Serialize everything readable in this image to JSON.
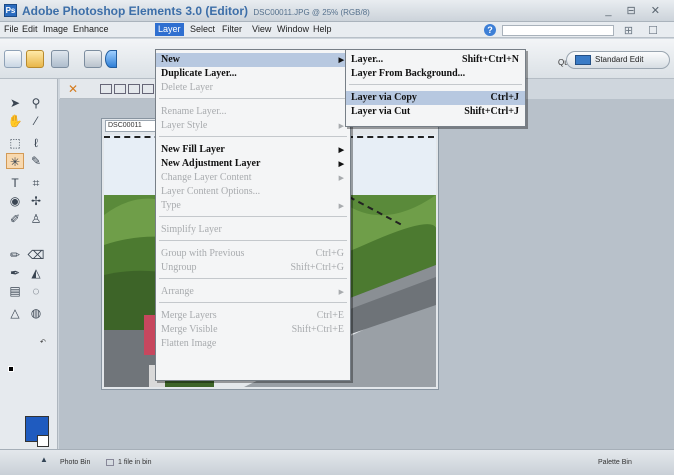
{
  "window": {
    "title": "Adobe Photoshop Elements 3.0 (Editor)",
    "subtitle": "DSC00011.JPG @ 25% (RGB/8)",
    "controls": "_ ⊟ ✕"
  },
  "menubar": {
    "items": [
      "File",
      "Edit",
      "Image",
      "Enhance",
      "Layer",
      "Select",
      "Filter",
      "View",
      "Window",
      "Help"
    ],
    "active_index": 4,
    "help_icon": "?",
    "right_icon": "⊞ ☐"
  },
  "shortcuts": {
    "quick_fix": "Quick Fix",
    "standard_edit": "Standard Edit"
  },
  "document": {
    "tab_label": "DSC00011"
  },
  "layer_menu": {
    "items": [
      {
        "label": "New",
        "shortcut": "",
        "submenu": true,
        "enabled": true,
        "highlighted": true
      },
      {
        "label": "Duplicate Layer...",
        "shortcut": "",
        "submenu": false,
        "enabled": true
      },
      {
        "label": "Delete Layer",
        "shortcut": "",
        "submenu": false,
        "enabled": false
      },
      {
        "label": "Rename Layer...",
        "shortcut": "",
        "submenu": false,
        "enabled": false
      },
      {
        "label": "Layer Style",
        "shortcut": "",
        "submenu": true,
        "enabled": false
      },
      {
        "label": "New Fill Layer",
        "shortcut": "",
        "submenu": true,
        "enabled": true
      },
      {
        "label": "New Adjustment Layer",
        "shortcut": "",
        "submenu": true,
        "enabled": true
      },
      {
        "label": "Change Layer Content",
        "shortcut": "",
        "submenu": true,
        "enabled": false
      },
      {
        "label": "Layer Content Options...",
        "shortcut": "",
        "submenu": false,
        "enabled": false
      },
      {
        "label": "Type",
        "shortcut": "",
        "submenu": true,
        "enabled": false
      },
      {
        "label": "Simplify Layer",
        "shortcut": "",
        "submenu": false,
        "enabled": false
      },
      {
        "label": "Group with Previous",
        "shortcut": "Ctrl+G",
        "submenu": false,
        "enabled": false
      },
      {
        "label": "Ungroup",
        "shortcut": "Shift+Ctrl+G",
        "submenu": false,
        "enabled": false
      },
      {
        "label": "Arrange",
        "shortcut": "",
        "submenu": true,
        "enabled": false
      },
      {
        "label": "Merge Layers",
        "shortcut": "Ctrl+E",
        "submenu": false,
        "enabled": false
      },
      {
        "label": "Merge Visible",
        "shortcut": "Shift+Ctrl+E",
        "submenu": false,
        "enabled": false
      },
      {
        "label": "Flatten Image",
        "shortcut": "",
        "submenu": false,
        "enabled": false
      }
    ]
  },
  "new_submenu": {
    "items": [
      {
        "label": "Layer...",
        "shortcut": "Shift+Ctrl+N",
        "highlighted": false
      },
      {
        "label": "Layer From Background...",
        "shortcut": "",
        "highlighted": false
      },
      {
        "label": "Layer via Copy",
        "shortcut": "Ctrl+J",
        "highlighted": true
      },
      {
        "label": "Layer via Cut",
        "shortcut": "Shift+Ctrl+J",
        "highlighted": false
      }
    ]
  },
  "statusbar": {
    "photo_bin": "Photo Bin",
    "file_count": "1 file in bin",
    "palette_bin": "Palette Bin"
  },
  "colors": {
    "accent": "#2f6fd0",
    "foreground_swatch": "#1f5bbf",
    "background_swatch": "#ffffff",
    "title_text": "#3c6ea8"
  }
}
